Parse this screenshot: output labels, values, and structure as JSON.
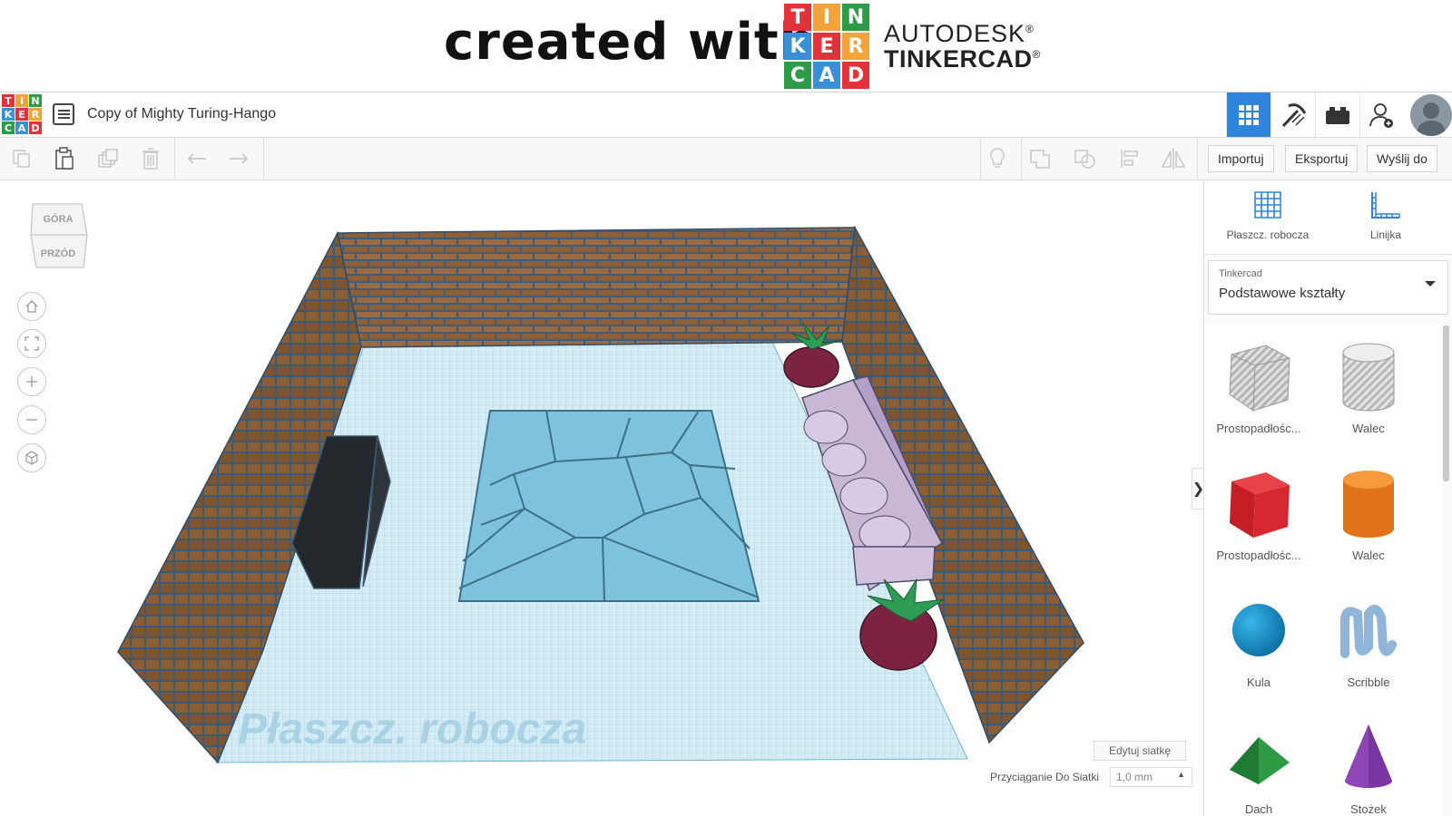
{
  "banner": {
    "text": "created with",
    "logo_letters": [
      "T",
      "I",
      "N",
      "K",
      "E",
      "R",
      "C",
      "A",
      "D"
    ],
    "logo_colors": [
      "#e2333a",
      "#f2a33a",
      "#2d9b47",
      "#3a8fd6",
      "#e2333a",
      "#f2a33a",
      "#2d9b47",
      "#3a8fd6",
      "#e2333a"
    ],
    "brand_line1": "AUTODESK",
    "brand_line2": "TINKERCAD",
    "registered": "®"
  },
  "header": {
    "design_title": "Copy of Mighty Turing-Hango",
    "views": [
      "grid-view-icon",
      "pickaxe-icon",
      "lego-brick-icon",
      "add-user-icon"
    ],
    "accent_color": "#2f84dc"
  },
  "toolbar": {
    "import_label": "Importuj",
    "export_label": "Eksportuj",
    "send_label": "Wyślij do"
  },
  "workspace": {
    "viewcube_top": "GÓRA",
    "viewcube_front": "PRZÓD",
    "workplane_watermark": "Płaszcz. robocza",
    "edit_grid_label": "Edytuj siatkę",
    "snap_label": "Przyciąganie Do Siatki",
    "snap_value": "1,0 mm",
    "collapse_glyph": "❯"
  },
  "panel": {
    "workplane_label": "Płaszcz. robocza",
    "ruler_label": "Linijka",
    "library_category": "Tinkercad",
    "library_name": "Podstawowe kształty",
    "shapes": [
      {
        "label": "Prostopadłośc...",
        "icon": "box-hole-icon"
      },
      {
        "label": "Walec",
        "icon": "cylinder-hole-icon"
      },
      {
        "label": "Prostopadłośc...",
        "icon": "box-red-icon"
      },
      {
        "label": "Walec",
        "icon": "cylinder-orange-icon"
      },
      {
        "label": "Kula",
        "icon": "sphere-icon"
      },
      {
        "label": "Scribble",
        "icon": "scribble-icon"
      },
      {
        "label": "Dach",
        "icon": "roof-icon"
      },
      {
        "label": "Stożek",
        "icon": "cone-icon"
      }
    ]
  }
}
